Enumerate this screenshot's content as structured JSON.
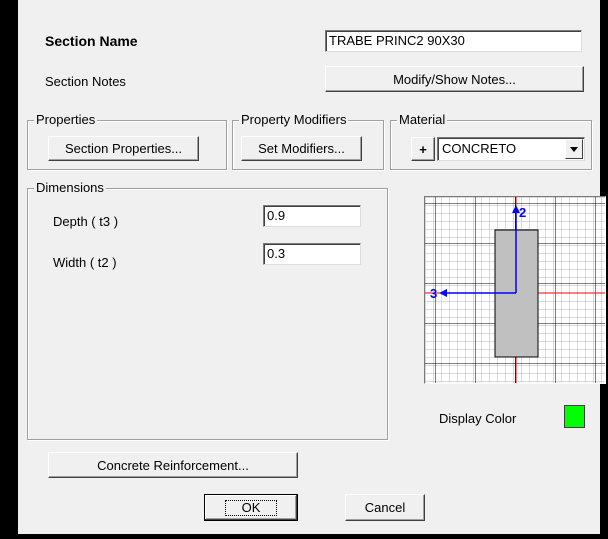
{
  "section": {
    "name_label": "Section Name",
    "name_value": "TRABE PRINC2 90X30",
    "notes_label": "Section Notes",
    "notes_button": "Modify/Show Notes..."
  },
  "properties": {
    "group_title": "Properties",
    "button": "Section Properties..."
  },
  "modifiers": {
    "group_title": "Property Modifiers",
    "button": "Set Modifiers..."
  },
  "material": {
    "group_title": "Material",
    "add_button": "+",
    "selected": "CONCRETO"
  },
  "dimensions": {
    "group_title": "Dimensions",
    "depth_label": "Depth  ( t3 )",
    "depth_value": "0.9",
    "width_label": "Width  ( t2 )",
    "width_value": "0.3"
  },
  "preview": {
    "axis_2_label": "2",
    "axis_3_label": "3",
    "section_fill": "#c0c0c0",
    "axis_color": "#0000ff",
    "centerline_color": "#ff0000"
  },
  "display_color": {
    "label": "Display Color",
    "color": "#00ff00"
  },
  "reinforcement_button": "Concrete Reinforcement...",
  "ok_button": "OK",
  "cancel_button": "Cancel"
}
